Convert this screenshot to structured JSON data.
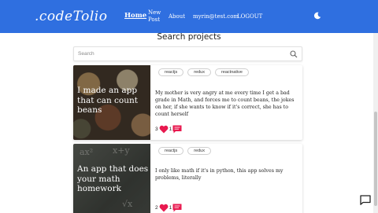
{
  "navbar": {
    "logo": ".codeTolio",
    "links": {
      "home": "Home",
      "new_post_1": "New",
      "new_post_2": "Post",
      "about": "About",
      "email": "myrin@test.com",
      "logout": "LOGOUT"
    },
    "theme_icon": "moon-icon",
    "bg_color": "#2f6fe0"
  },
  "page": {
    "title": "Search projects",
    "search_placeholder": "Search",
    "search_icon": "search-icon"
  },
  "projects": [
    {
      "title": "I made an app that can count beans",
      "tags": [
        "reactjs",
        "redux",
        "reactnative"
      ],
      "description": "My mother is very angry at me every time I get a bad grade in Math, and forces me to count beans, the jokes on her, if she wants to know if it's correct, she has to count herself",
      "likes": "3",
      "comments": "1"
    },
    {
      "title": "An app that does your math homework",
      "tags": [
        "reactjs",
        "redux"
      ],
      "description": "I only like math if it's in python, this app solves my problems, literally",
      "likes": "2",
      "comments": "1"
    }
  ],
  "colors": {
    "heart": "#e8194f",
    "comment": "#e8194f"
  },
  "chat_icon": "chat-icon"
}
